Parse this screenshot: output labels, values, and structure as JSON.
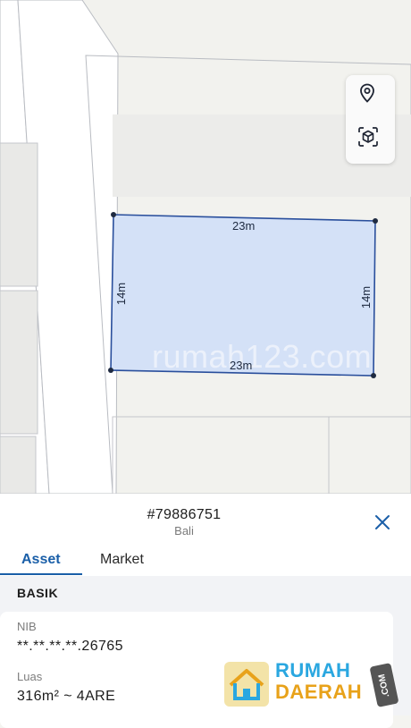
{
  "map": {
    "parcel": {
      "top_label": "23m",
      "bottom_label": "23m",
      "left_label": "14m",
      "right_label": "14m",
      "fill_color": "#d4e1f7",
      "stroke_color": "#2a4f9c"
    },
    "watermark": "rumah123.com",
    "controls": [
      {
        "icon": "location-pin-icon"
      },
      {
        "icon": "3d-box-icon"
      }
    ]
  },
  "sheet": {
    "plot_id": "#79886751",
    "region": "Bali",
    "tabs": [
      {
        "label": "Asset",
        "active": true
      },
      {
        "label": "Market",
        "active": false
      }
    ],
    "section_title": "BASIK",
    "fields": [
      {
        "label": "NIB",
        "value": "**.**.**.**.26765"
      },
      {
        "label": "Luas",
        "value": "316m² ~ 4ARE"
      }
    ]
  },
  "logo": {
    "line1": "RUMAH",
    "line2": "DAERAH",
    "suffix": ".COM",
    "colors": {
      "line1": "#2aa7e0",
      "line2": "#e8a21a"
    }
  },
  "colors": {
    "accent": "#1a5fa8",
    "map_background": "#f2f2ee"
  }
}
